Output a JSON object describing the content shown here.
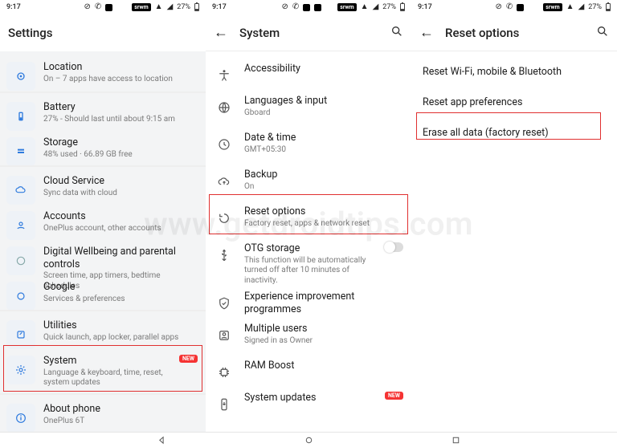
{
  "status": {
    "time": "9:17",
    "battery_pct": "27%",
    "carrier": "srwm"
  },
  "watermark": "www.getdroidtips.com",
  "panel1": {
    "title": "Settings",
    "items": {
      "location": {
        "label": "Location",
        "sub": "On – 7 apps have access to location"
      },
      "battery": {
        "label": "Battery",
        "sub": "27% - Should last until about 9:15 am"
      },
      "storage": {
        "label": "Storage",
        "sub": "48% used · 66.89 GB free"
      },
      "cloud": {
        "label": "Cloud Service",
        "sub": "Sync data with cloud"
      },
      "accounts": {
        "label": "Accounts",
        "sub": "OnePlus account, other accounts"
      },
      "wellbeing": {
        "label": "Digital Wellbeing and parental controls",
        "sub": "Screen time, app timers, bedtime schedules"
      },
      "google": {
        "label": "Google",
        "sub": "Services & preferences"
      },
      "utilities": {
        "label": "Utilities",
        "sub": "Quick launch, app locker, parallel apps"
      },
      "system": {
        "label": "System",
        "sub": "Language & keyboard, time, reset, system updates",
        "badge": "NEW"
      },
      "about": {
        "label": "About phone",
        "sub": "OnePlus 6T"
      }
    }
  },
  "panel2": {
    "title": "System",
    "items": {
      "accessibility": {
        "label": "Accessibility"
      },
      "languages": {
        "label": "Languages & input",
        "sub": "Gboard"
      },
      "datetime": {
        "label": "Date & time",
        "sub": "GMT+05:30"
      },
      "backup": {
        "label": "Backup",
        "sub": "On"
      },
      "reset": {
        "label": "Reset options",
        "sub": "Factory reset, apps & network reset"
      },
      "otg": {
        "label": "OTG storage",
        "sub": "This function will be automatically turned off after 10 minutes of inactivity."
      },
      "experience": {
        "label": "Experience improvement programmes"
      },
      "multiuser": {
        "label": "Multiple users",
        "sub": "Signed in as Owner"
      },
      "ramboost": {
        "label": "RAM Boost"
      },
      "sysupdates": {
        "label": "System updates",
        "badge": "NEW"
      }
    }
  },
  "panel3": {
    "title": "Reset options",
    "options": {
      "wifi": "Reset Wi-Fi, mobile & Bluetooth",
      "prefs": "Reset app preferences",
      "erase": "Erase all data (factory reset)"
    }
  }
}
